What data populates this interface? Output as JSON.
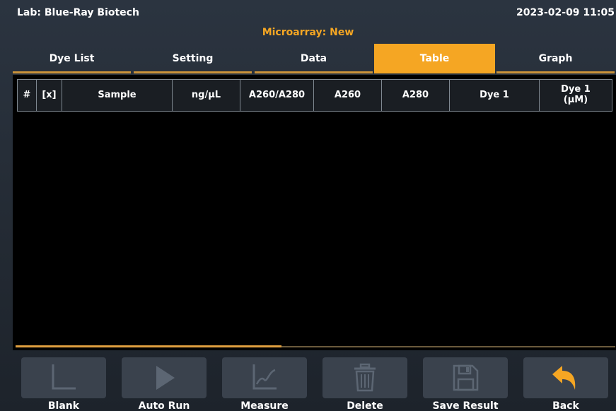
{
  "header": {
    "lab": "Lab: Blue-Ray Biotech",
    "datetime": "2023-02-09 11:05",
    "title": "Microarray: New"
  },
  "tabs": [
    {
      "label": "Dye List",
      "active": false
    },
    {
      "label": "Setting",
      "active": false
    },
    {
      "label": "Data",
      "active": false
    },
    {
      "label": "Table",
      "active": true
    },
    {
      "label": "Graph",
      "active": false
    }
  ],
  "table": {
    "columns": [
      "#",
      "[x]",
      "Sample",
      "ng/μL",
      "A260/A280",
      "A260",
      "A280",
      "Dye 1",
      "Dye 1\n(μM)"
    ],
    "rows": []
  },
  "toolbar": [
    {
      "label": "Blank",
      "icon": "blank-axis-icon"
    },
    {
      "label": "Auto Run",
      "icon": "play-icon"
    },
    {
      "label": "Measure",
      "icon": "measure-curve-icon"
    },
    {
      "label": "Delete",
      "icon": "trash-icon"
    },
    {
      "label": "Save Result",
      "icon": "save-icon"
    },
    {
      "label": "Back",
      "icon": "back-arrow-icon"
    }
  ],
  "colors": {
    "accent": "#f5a623",
    "background": "#232a33",
    "button": "#3a424d",
    "icon_muted": "#5c6673"
  }
}
